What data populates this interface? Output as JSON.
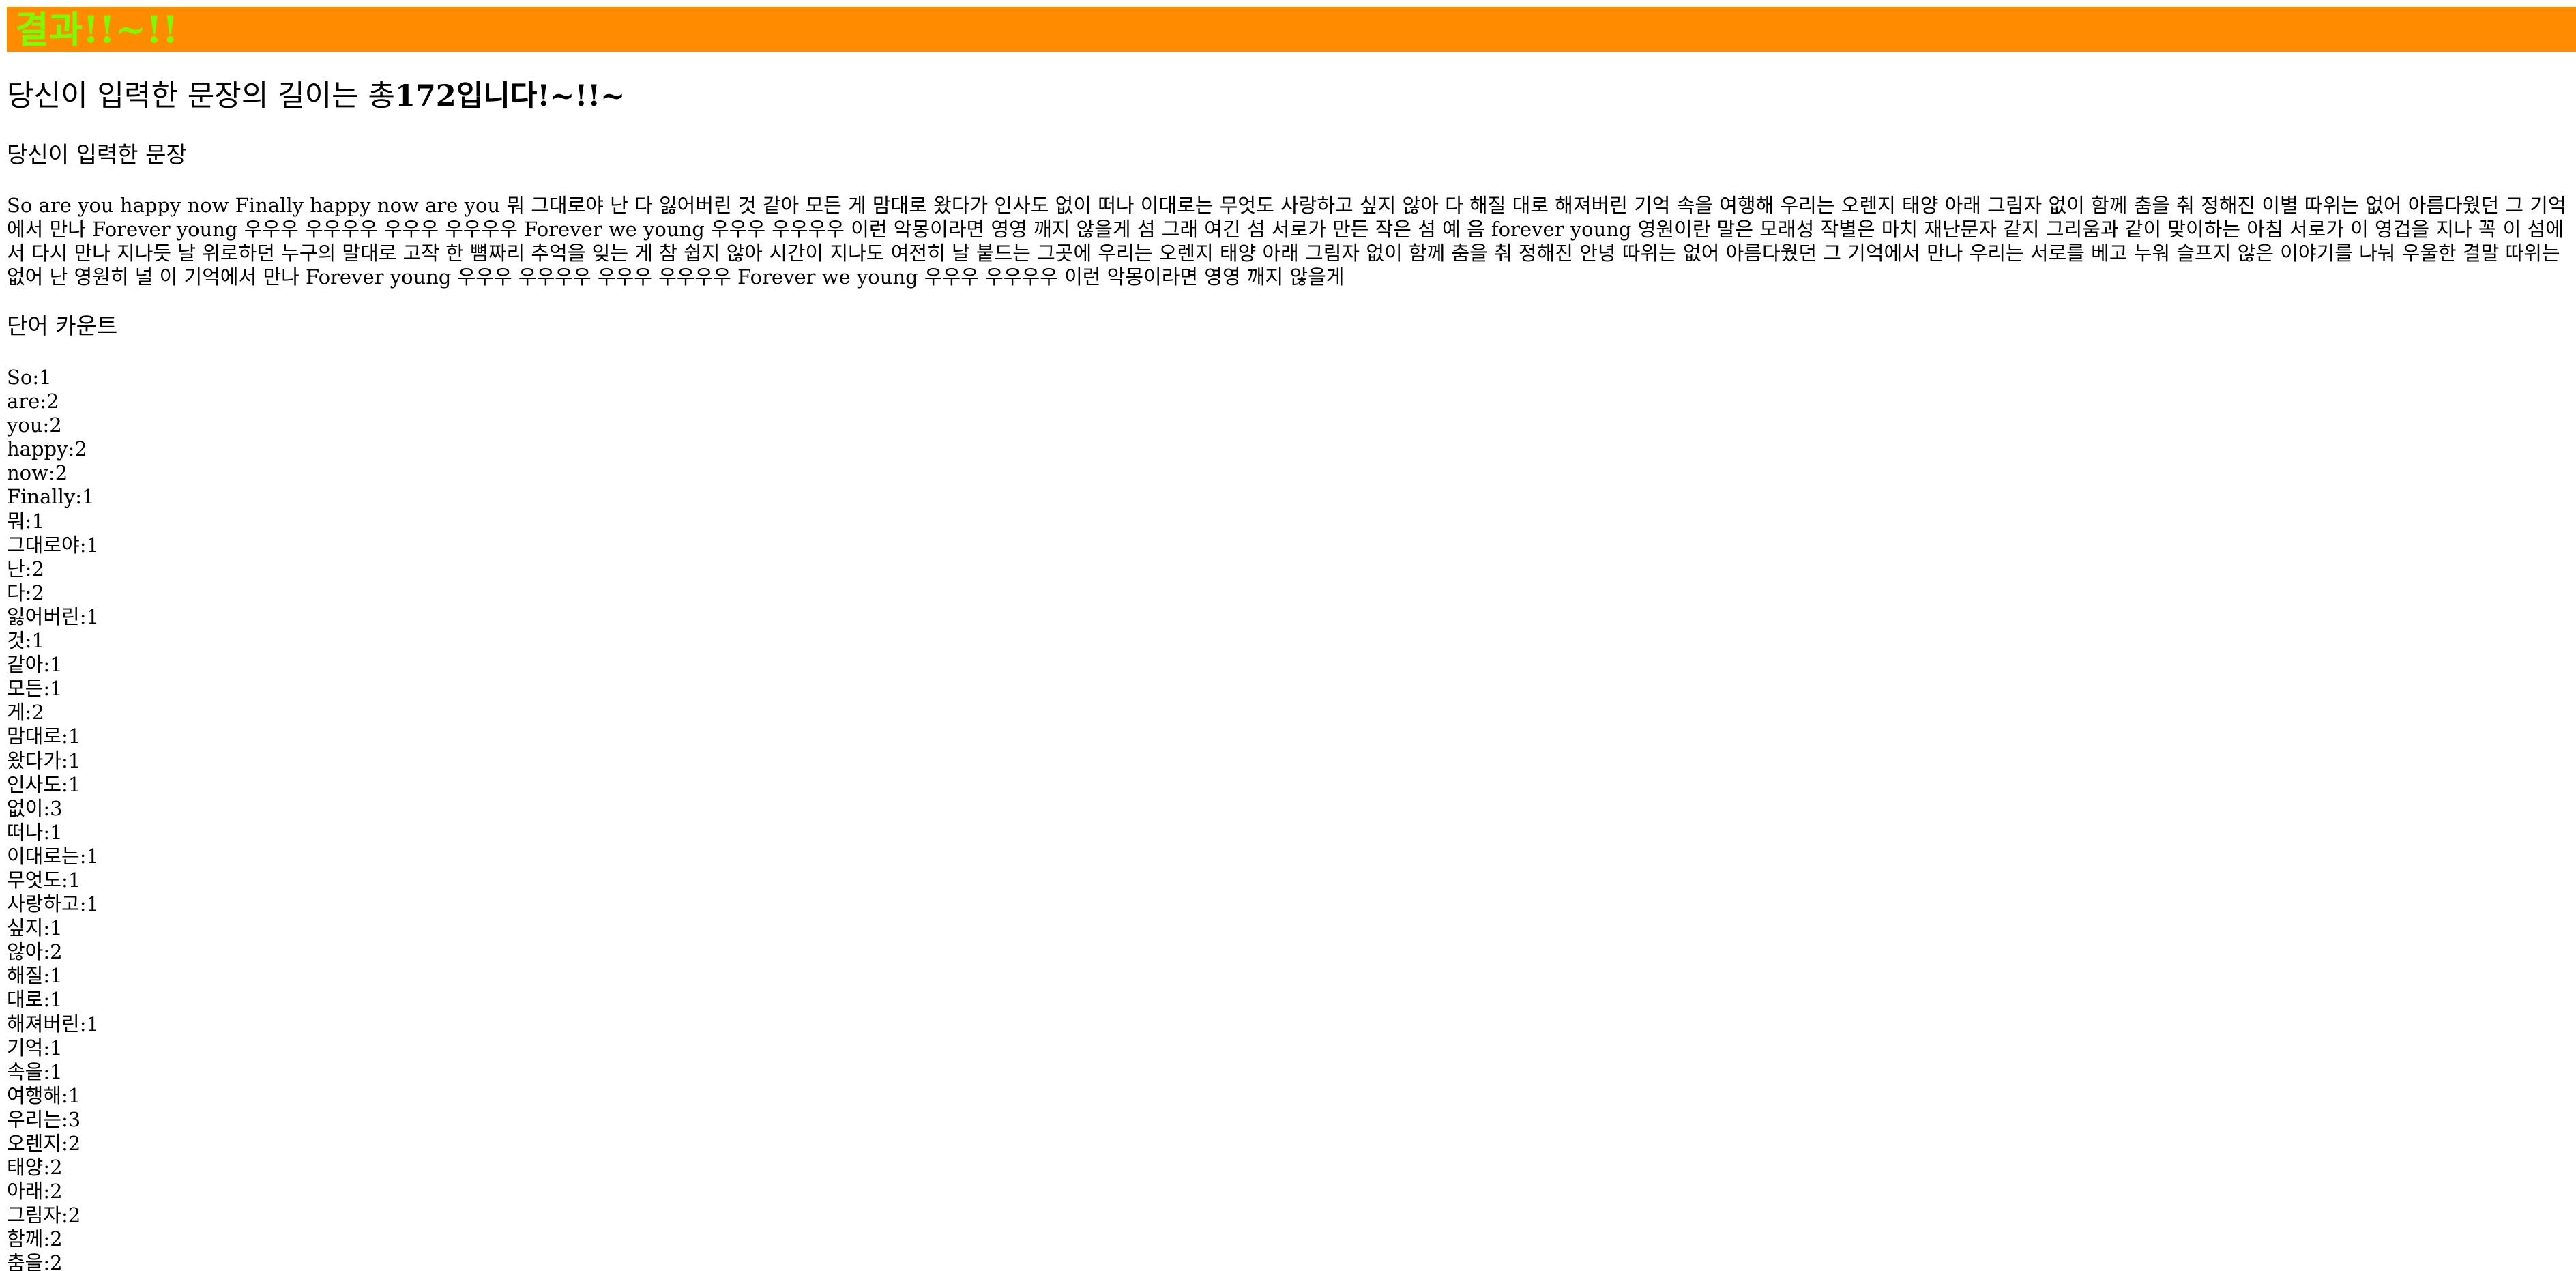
{
  "banner": {
    "title": "결과!!~!!",
    "background": "#ff8c00",
    "title_color": "#7cfc00"
  },
  "length_result": {
    "prefix": "당신이 입력한 문장의 길이는 총",
    "count": "172",
    "suffix": "입니다!~!!~"
  },
  "sentence_section": {
    "heading": "당신이 입력한 문장",
    "text": "So are you happy now Finally happy now are you 뭐 그대로야 난 다 잃어버린 것 같아 모든 게 맘대로 왔다가 인사도 없이 떠나 이대로는 무엇도 사랑하고 싶지 않아 다 해질 대로 해져버린 기억 속을 여행해 우리는 오렌지 태양 아래 그림자 없이 함께 춤을 춰 정해진 이별 따위는 없어 아름다웠던 그 기억에서 만나 Forever young 우우우 우우우우 우우우 우우우우 Forever we young 우우우 우우우우 이런 악몽이라면 영영 깨지 않을게 섬 그래 여긴 섬 서로가 만든 작은 섬 예 음 forever young 영원이란 말은 모래성 작별은 마치 재난문자 같지 그리움과 같이 맞이하는 아침 서로가 이 영겁을 지나 꼭 이 섬에서 다시 만나 지나듯 날 위로하던 누구의 말대로 고작 한 뼘짜리 추억을 잊는 게 참 쉽지 않아 시간이 지나도 여전히 날 붙드는 그곳에 우리는 오렌지 태양 아래 그림자 없이 함께 춤을 춰 정해진 안녕 따위는 없어 아름다웠던 그 기억에서 만나 우리는 서로를 베고 누워 슬프지 않은 이야기를 나눠 우울한 결말 따위는 없어 난 영원히 널 이 기억에서 만나 Forever young 우우우 우우우우 우우우 우우우우 Forever we young 우우우 우우우우 이런 악몽이라면 영영 깨지 않을게"
  },
  "word_count_section": {
    "heading": "단어 카운트",
    "items": [
      "So:1",
      "are:2",
      "you:2",
      "happy:2",
      "now:2",
      "Finally:1",
      "뭐:1",
      "그대로야:1",
      "난:2",
      "다:2",
      "잃어버린:1",
      "것:1",
      "같아:1",
      "모든:1",
      "게:2",
      "맘대로:1",
      "왔다가:1",
      "인사도:1",
      "없이:3",
      "떠나:1",
      "이대로는:1",
      "무엇도:1",
      "사랑하고:1",
      "싶지:1",
      "않아:2",
      "해질:1",
      "대로:1",
      "해져버린:1",
      "기억:1",
      "속을:1",
      "여행해:1",
      "우리는:3",
      "오렌지:2",
      "태양:2",
      "아래:2",
      "그림자:2",
      "함께:2",
      "춤을:2"
    ]
  }
}
